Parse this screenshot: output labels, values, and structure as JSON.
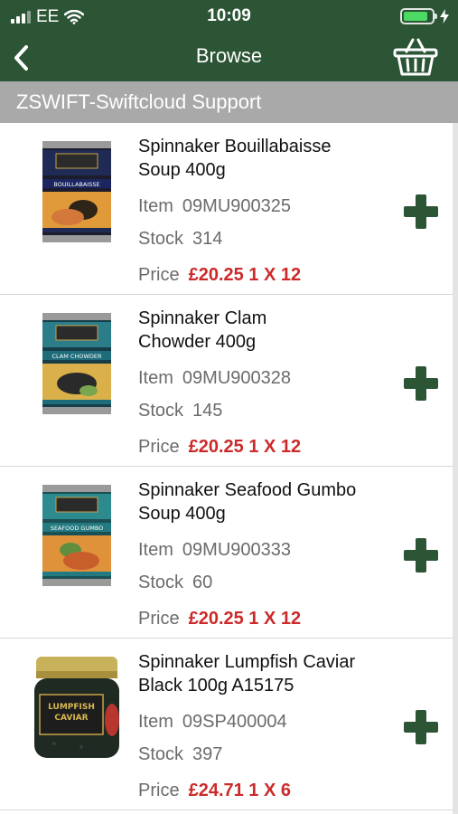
{
  "status_bar": {
    "carrier": "EE",
    "time": "10:09",
    "battery_level": 0.85,
    "battery_color": "#4cd964"
  },
  "nav": {
    "title": "Browse",
    "back_icon": "chevron-left-icon",
    "basket_icon": "basket-icon"
  },
  "account": {
    "name": "ZSWIFT-Swiftcloud Support"
  },
  "labels": {
    "item": "Item",
    "stock": "Stock",
    "price": "Price"
  },
  "theme": {
    "header_bg": "#2c5535",
    "subheader_bg": "#a9a9a9",
    "price_color": "#cc2a2a",
    "add_button_color": "#2c5535"
  },
  "products": [
    {
      "name_line1": "Spinnaker Bouillabaisse",
      "name_line2": "Soup 400g",
      "item": "09MU900325",
      "stock": "314",
      "price": "£20.25 1 X 12",
      "image": "can-bouillabaisse",
      "image_label": "BOUILLABAISSE"
    },
    {
      "name_line1": "Spinnaker Clam",
      "name_line2": "Chowder 400g",
      "item": "09MU900328",
      "stock": "145",
      "price": "£20.25 1 X 12",
      "image": "can-clam-chowder",
      "image_label": "CLAM CHOWDER"
    },
    {
      "name_line1": "Spinnaker Seafood Gumbo",
      "name_line2": "Soup 400g",
      "item": "09MU900333",
      "stock": "60",
      "price": "£20.25 1 X 12",
      "image": "can-seafood-gumbo",
      "image_label": "SEAFOOD GUMBO"
    },
    {
      "name_line1": "Spinnaker Lumpfish Caviar",
      "name_line2": "Black 100g A15175",
      "item": "09SP400004",
      "stock": "397",
      "price": "£24.71 1 X 6",
      "image": "jar-lumpfish-caviar",
      "image_label": "LUMPFISH CAVIAR"
    }
  ]
}
